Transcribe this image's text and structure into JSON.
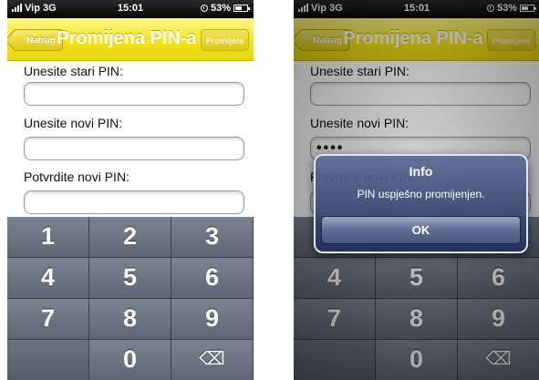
{
  "status_bar": {
    "carrier": "Vip",
    "network": "3G",
    "time": "15:01",
    "battery": "53%",
    "battery_fraction": 0.53
  },
  "navbar": {
    "back_label": "Natrag",
    "title": "Promijena PIN-a",
    "right_button_label": "Promijeni"
  },
  "form": {
    "old_pin_label": "Unesite stari PIN:",
    "new_pin_label": "Unesite novi PIN:",
    "confirm_pin_label": "Potvrdite novi PIN:"
  },
  "right_screen": {
    "new_pin_value": "••••",
    "confirm_label_visible": "Potvrdite novi PIN"
  },
  "keypad": {
    "keys": [
      "1",
      "2",
      "3",
      "4",
      "5",
      "6",
      "7",
      "8",
      "9",
      "",
      "0",
      "⌫"
    ]
  },
  "alert": {
    "title": "Info",
    "message": "PIN uspješno promijenjen.",
    "button": "OK"
  },
  "colors": {
    "navbar_yellow": "#f2e21b",
    "keypad_gray": "#5d6672",
    "alert_blue": "#2a3c74"
  }
}
